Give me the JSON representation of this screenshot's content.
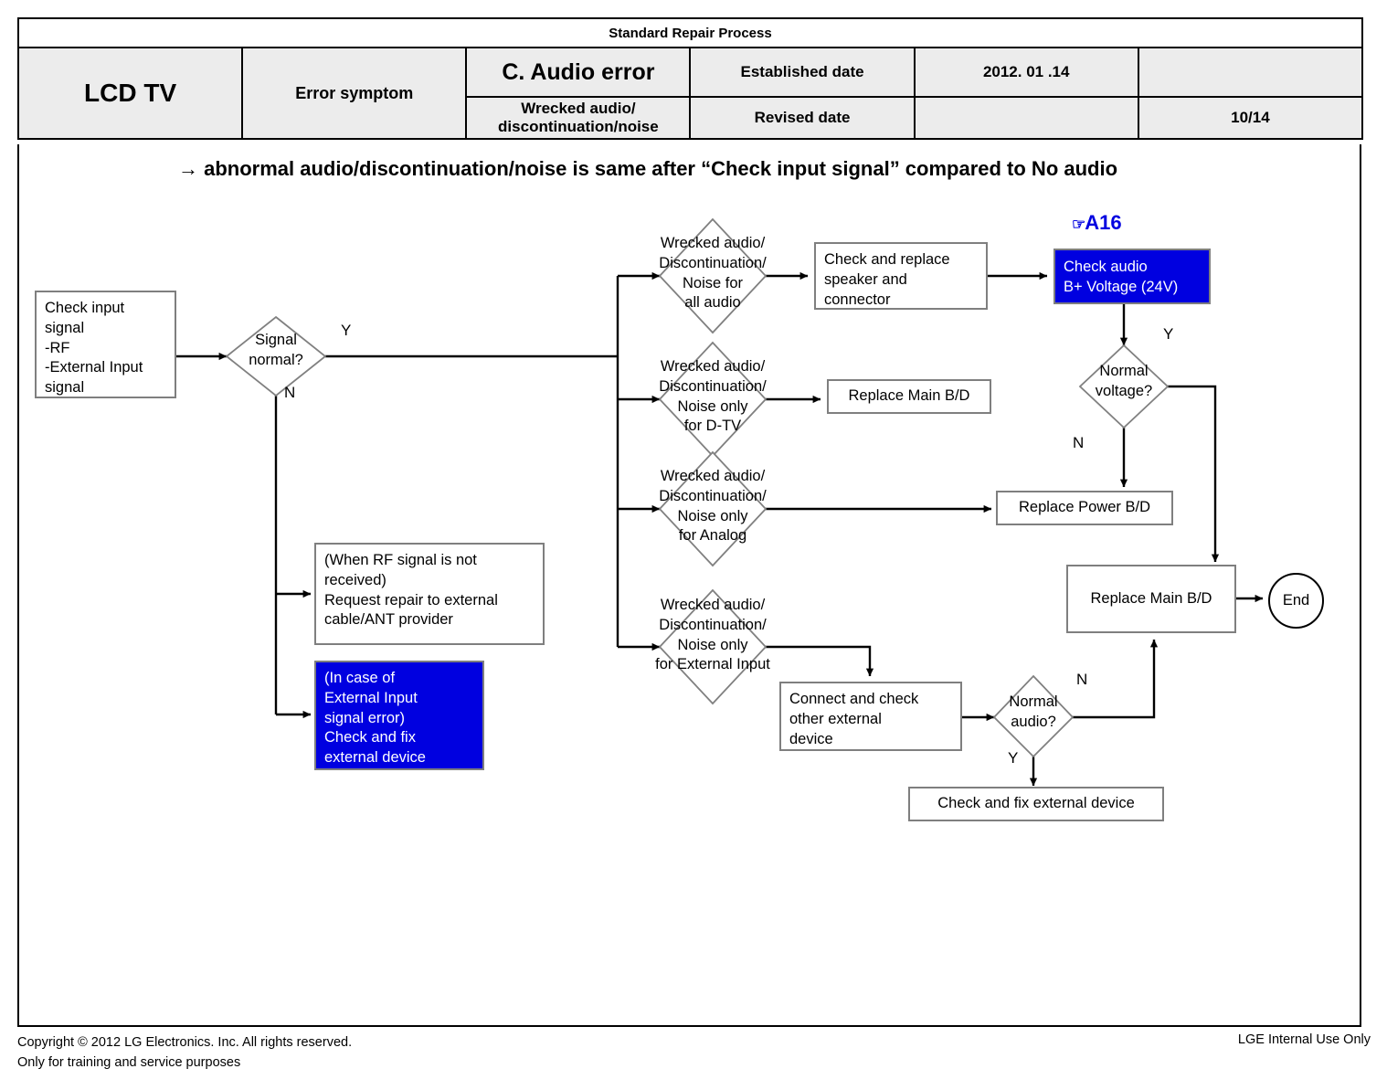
{
  "header": {
    "process_title": "Standard Repair Process",
    "product": "LCD  TV",
    "error_symptom_label": "Error\nsymptom",
    "error_title": "C. Audio error",
    "error_subtitle": "Wrecked audio/ discontinuation/noise",
    "established_date_label": "Established\ndate",
    "established_date_value": "2012. 01 .14",
    "revised_date_label": "Revised date",
    "revised_date_value": "",
    "top_right_blank": "",
    "page_number": "10/14"
  },
  "note": "→ abnormal audio/discontinuation/noise is same after “Check input signal” compared to No audio",
  "annotation": {
    "hand_icon": "☞",
    "ref_label": "A16",
    "color": "#0000e0"
  },
  "nodes": {
    "check_input_signal": "Check input\nsignal\n-RF\n-External Input\nsignal",
    "signal_normal": "Signal\nnormal?",
    "rf_not_received": "(When RF signal is not\nreceived)\nRequest repair to external\ncable/ANT provider",
    "external_input_error": "(In case of\nExternal Input\nsignal error)\nCheck and fix\nexternal device",
    "wrecked_all_audio": "Wrecked audio/\nDiscontinuation/\nNoise for\nall audio",
    "wrecked_dtv": "Wrecked audio/\nDiscontinuation/\nNoise only\nfor D-TV",
    "wrecked_analog": "Wrecked audio/\nDiscontinuation/\nNoise only\nfor Analog",
    "wrecked_external": "Wrecked audio/\nDiscontinuation/\nNoise only\nfor External Input",
    "check_replace_speaker": "Check and replace\nspeaker and\nconnector",
    "replace_main_bd_1": "Replace Main B/D",
    "check_audio_bplus": "Check audio\nB+ Voltage (24V)",
    "normal_voltage": "Normal\nvoltage?",
    "replace_power_bd": "Replace Power B/D",
    "replace_main_bd_2": "Replace Main B/D",
    "end": "End",
    "connect_check_other": "Connect and check\nother external\ndevice",
    "normal_audio": "Normal\naudio?",
    "check_fix_external": "Check and fix external device"
  },
  "branches": {
    "signal_normal_yes": "Y",
    "signal_normal_no": "N",
    "normal_voltage_yes": "Y",
    "normal_voltage_no": "N",
    "normal_audio_yes": "Y",
    "normal_audio_no": "N"
  },
  "footer": {
    "copyright_line1": "Copyright © 2012 LG Electronics. Inc. All rights reserved.",
    "copyright_line2": "Only for training and service purposes",
    "internal_use": "LGE Internal Use Only"
  },
  "colors": {
    "highlight_blue": "#0000e0",
    "box_border": "#7f7f7f",
    "header_fill": "#ececec"
  }
}
